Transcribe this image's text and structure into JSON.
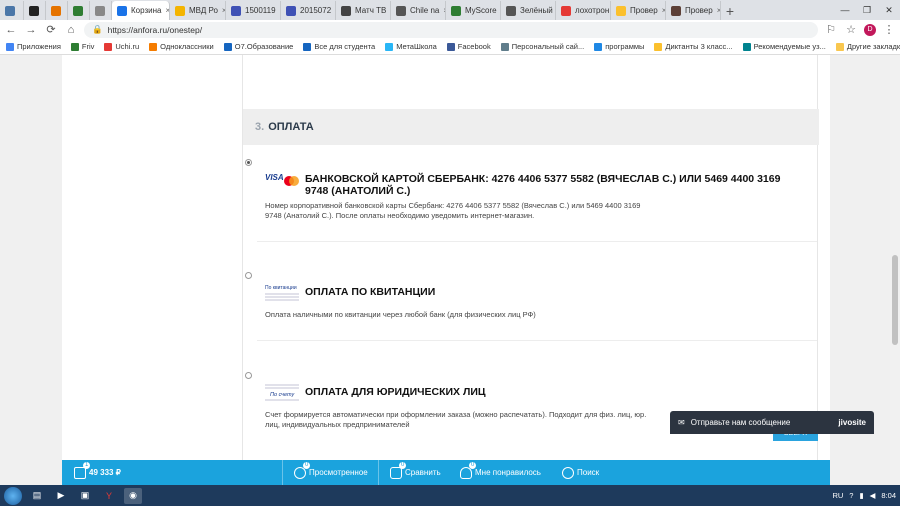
{
  "browser": {
    "tabs": [
      {
        "label": "",
        "color": "#4a76a8",
        "active": false
      },
      {
        "label": "",
        "color": "#222222",
        "active": false
      },
      {
        "label": "",
        "color": "#e57300",
        "active": false
      },
      {
        "label": "",
        "color": "#2e7d32",
        "active": false
      },
      {
        "label": "",
        "color": "#888888",
        "active": false
      },
      {
        "label": "Корзина",
        "color": "#1a73e8",
        "active": true
      },
      {
        "label": "МВД Ро",
        "color": "#f4b400",
        "active": false
      },
      {
        "label": "1500119",
        "color": "#3f51b5",
        "active": false
      },
      {
        "label": "2015072",
        "color": "#3f51b5",
        "active": false
      },
      {
        "label": "Матч ТВ",
        "color": "#444444",
        "active": false
      },
      {
        "label": "Chile na",
        "color": "#555555",
        "active": false
      },
      {
        "label": "MyScore",
        "color": "#2e7d32",
        "active": false
      },
      {
        "label": "Зелёный",
        "color": "#555555",
        "active": false
      },
      {
        "label": "лохотрон",
        "color": "#e53935",
        "active": false
      },
      {
        "label": "Провер",
        "color": "#fbc02d",
        "active": false
      },
      {
        "label": "Провер",
        "color": "#5d4037",
        "active": false
      }
    ],
    "tab_labels_wiki": "W",
    "new_tab": "+",
    "window": {
      "minimize": "—",
      "maximize": "❐",
      "close": "✕"
    },
    "url": "https://anfora.ru/onestep/",
    "profile_initial": "D"
  },
  "bookmarks": [
    {
      "label": "Приложения",
      "color": "#4285f4"
    },
    {
      "label": "Friv",
      "color": "#2e7d32"
    },
    {
      "label": "Uchi.ru",
      "color": "#e53935"
    },
    {
      "label": "Одноклассники",
      "color": "#f57c00"
    },
    {
      "label": "О7.Образование",
      "color": "#1565c0"
    },
    {
      "label": "Все для студента",
      "color": "#1565c0"
    },
    {
      "label": "МетаШкола",
      "color": "#29b6f6"
    },
    {
      "label": "Facebook",
      "color": "#3b5998"
    },
    {
      "label": "Персональный сай...",
      "color": "#607d8b"
    },
    {
      "label": "программы",
      "color": "#1e88e5"
    },
    {
      "label": "Диктанты 3 класс...",
      "color": "#fbc02d"
    },
    {
      "label": "Рекомендуемые уз...",
      "color": "#00838f"
    }
  ],
  "bookmarks_other": "Другие закладки",
  "checkout": {
    "section_number": "3.",
    "section_title": "ОПЛАТА",
    "options": [
      {
        "title": "БАНКОВСКОЙ КАРТОЙ СБЕРБАНК: 4276 4406 5377 5582 (ВЯЧЕСЛАВ С.) ИЛИ 5469 4400 3169 9748 (АНАТОЛИЙ С.)",
        "description": "Номер корпоративной банковской карты Сбербанк: 4276 4406 5377 5582 (Вячеслав С.) или 5469 4400 3169 9748 (Анатолий С.). После оплаты необходимо уведомить интернет-магазин.",
        "selected": true,
        "logo": "visa-mastercard-icon"
      },
      {
        "title": "ОПЛАТА ПО КВИТАНЦИИ",
        "description": "Оплата наличными по квитанции через любой банк (для физических лиц РФ)",
        "selected": false,
        "logo_text": "По квитанции"
      },
      {
        "title": "ОПЛАТА ДЛЯ ЮРИДИЧЕСКИХ ЛИЦ",
        "description": "Счет формируется автоматически при оформлении заказа (можно распечатать). Подходит для физ. лиц, юр. лиц, индивидуальных предпринимателей",
        "selected": false,
        "logo_text": "По счету"
      }
    ]
  },
  "scroll_up_label": "ВВЕРХ",
  "sitebar": {
    "cart_count": "1",
    "cart_total": "49 333 ₽",
    "viewed_count": "0",
    "viewed_label": "Просмотренное",
    "compare_count": "0",
    "compare_label": "Сравнить",
    "liked_count": "0",
    "liked_label": "Мне понравилось",
    "search_label": "Поиск"
  },
  "chat": {
    "label": "Отправьте нам сообщение",
    "brand": "jivosite"
  },
  "taskbar": {
    "lang": "RU",
    "time": "8:04"
  },
  "colors": {
    "sitebar": "#1ba3dd",
    "chat": "#2c3440"
  }
}
